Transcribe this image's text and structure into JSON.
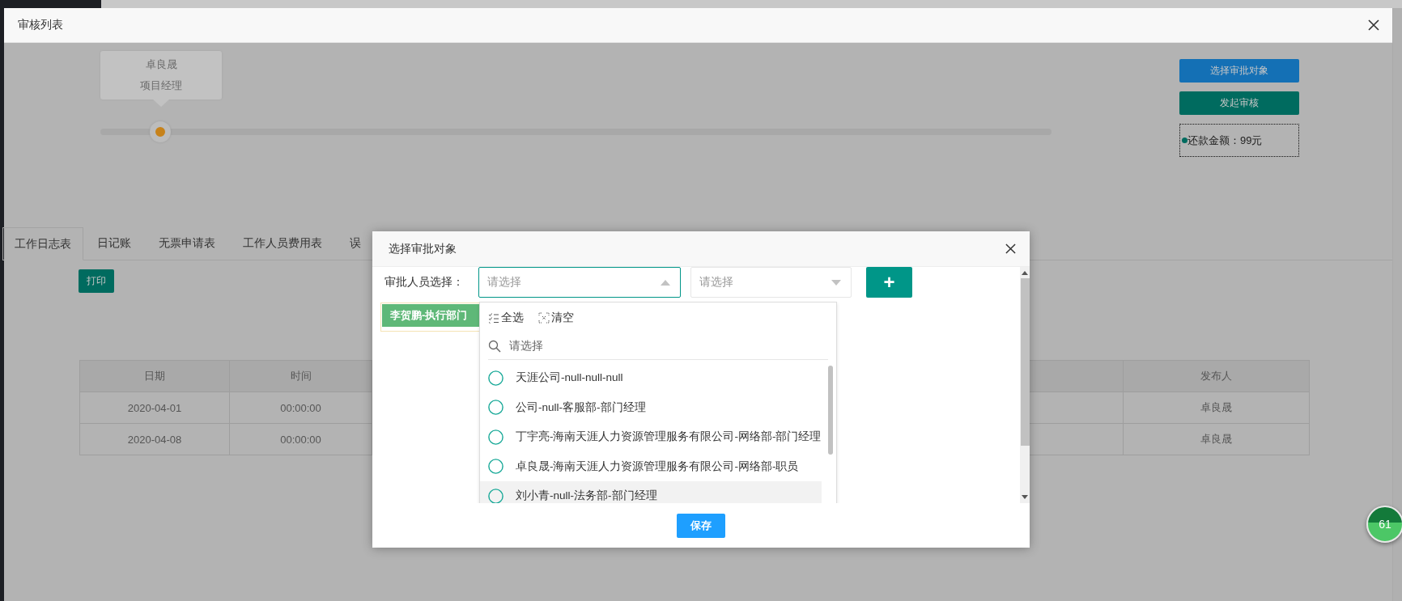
{
  "window": {
    "title": "审核列表"
  },
  "approval_flow": {
    "nodes": [
      {
        "name": "卓良晟",
        "role": "项目经理"
      }
    ],
    "level": 0.063
  },
  "actions": [
    {
      "kind": "select",
      "label": "选择审批对象"
    },
    {
      "kind": "submit",
      "label": "发起审核"
    }
  ],
  "amount_note": "还款金额：99元",
  "tabs": [
    {
      "label": "工作日志表",
      "selected": true
    },
    {
      "label": "日记账",
      "selected": false
    },
    {
      "label": "无票申请表",
      "selected": false
    },
    {
      "label": "工作人员费用表",
      "selected": false
    },
    {
      "label": "误",
      "selected": false
    }
  ],
  "print_button": "打印",
  "table": {
    "columns": [
      "日期",
      "时间",
      "发布人"
    ],
    "rows": [
      [
        "2020-04-01",
        "00:00:00",
        "卓良晟"
      ],
      [
        "2020-04-08",
        "00:00:00",
        "卓良晟"
      ]
    ]
  },
  "dialog": {
    "title": "选择审批对象",
    "field_label": "审批人员选择：",
    "selects": [
      {
        "placeholder": "请选择",
        "expanded": true
      },
      {
        "placeholder": "请选择",
        "expanded": false
      }
    ],
    "add_button": "+",
    "tags": [
      "李贺鹏-执行部门"
    ],
    "dropdown": {
      "select_all": "全选",
      "clear": "清空",
      "search_placeholder": "请选择",
      "options": [
        {
          "label": "天涯公司-null-null-null",
          "selected": false,
          "highlighted": false
        },
        {
          "label": "公司-null-客服部-部门经理",
          "selected": false,
          "highlighted": false
        },
        {
          "label": "丁宇亮-海南天涯人力资源管理服务有限公司-网络部-部门经理",
          "selected": false,
          "highlighted": false
        },
        {
          "label": "卓良晟-海南天涯人力资源管理服务有限公司-网络部-职员",
          "selected": false,
          "highlighted": false
        },
        {
          "label": "刘小青-null-法务部-部门经理",
          "selected": false,
          "highlighted": true
        }
      ]
    },
    "save_button": "保存"
  },
  "floating_badge": "61"
}
